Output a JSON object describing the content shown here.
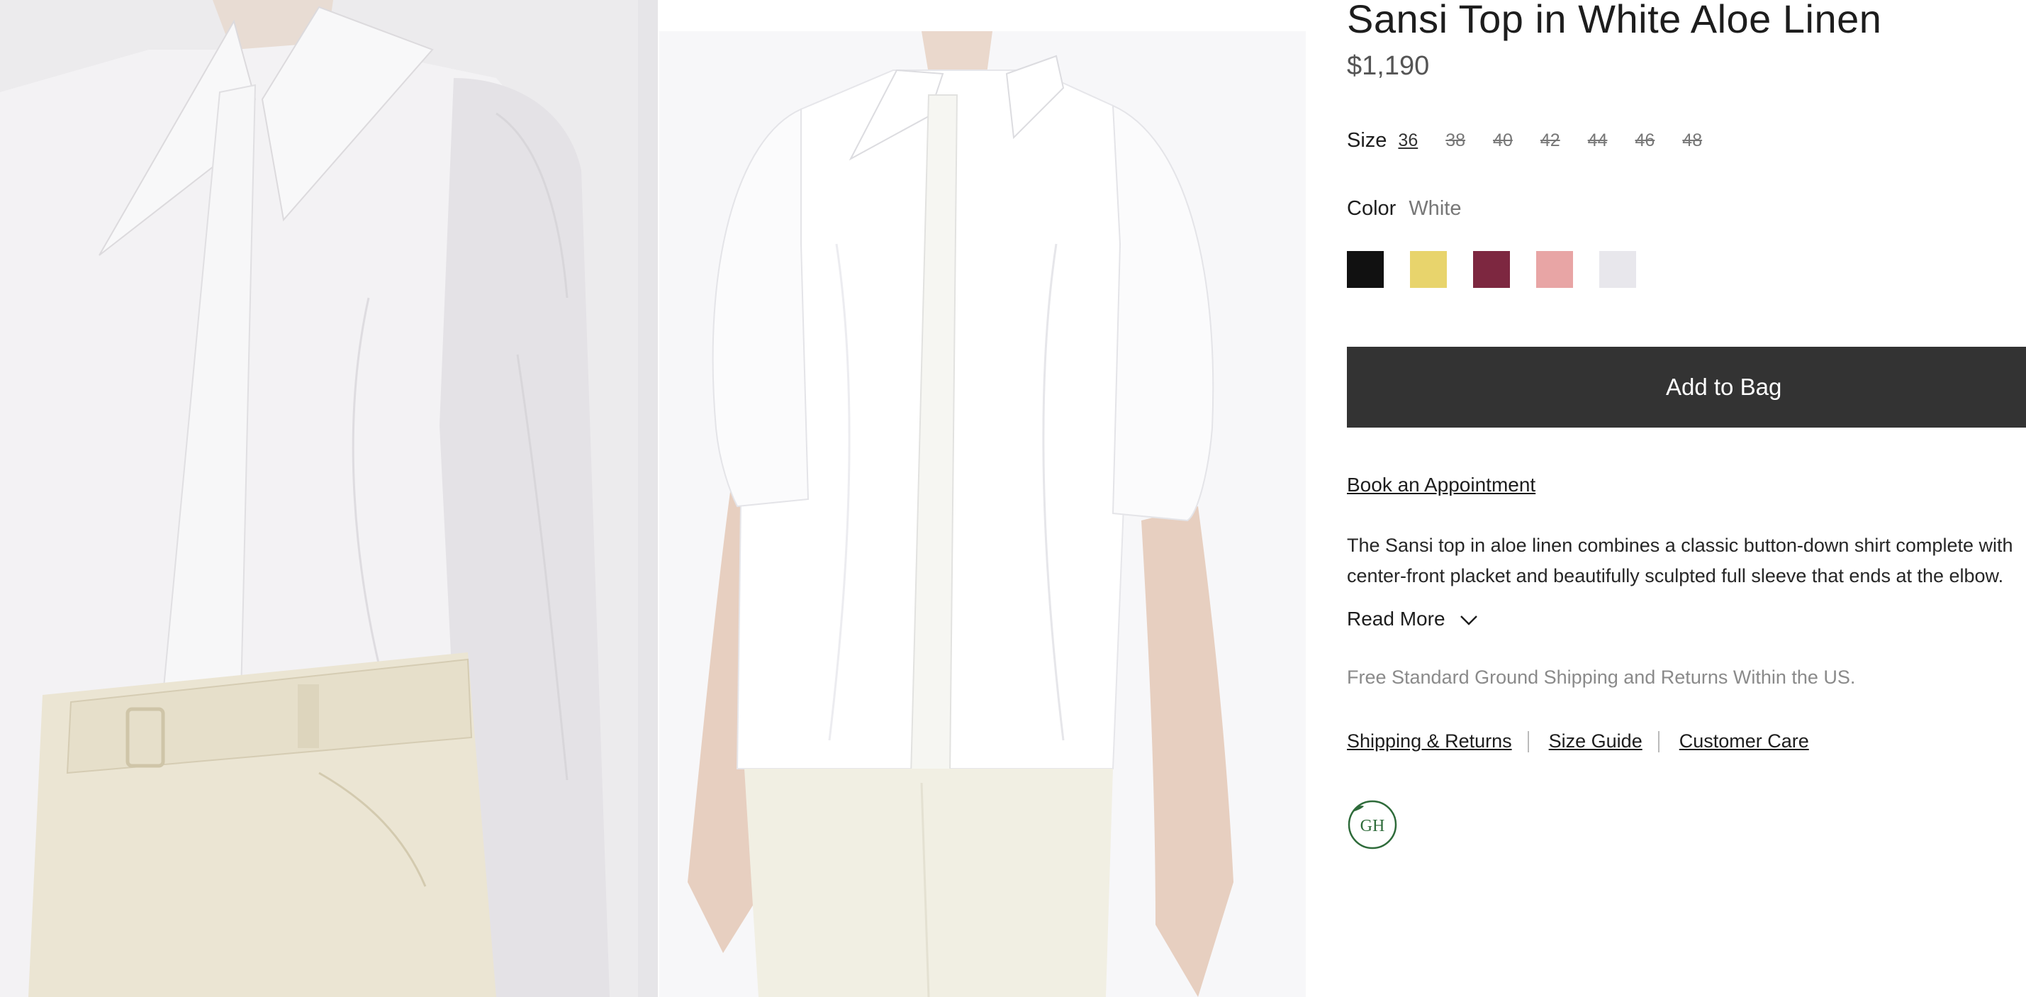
{
  "product": {
    "title": "Sansi Top in White Aloe Linen",
    "price": "$1,190"
  },
  "size": {
    "label": "Size",
    "options": [
      {
        "value": "36",
        "available": true,
        "selected": true
      },
      {
        "value": "38",
        "available": false,
        "selected": false
      },
      {
        "value": "40",
        "available": false,
        "selected": false
      },
      {
        "value": "42",
        "available": false,
        "selected": false
      },
      {
        "value": "44",
        "available": false,
        "selected": false
      },
      {
        "value": "46",
        "available": false,
        "selected": false
      },
      {
        "value": "48",
        "available": false,
        "selected": false
      }
    ]
  },
  "color": {
    "label": "Color",
    "selected": "White",
    "swatches": [
      {
        "hex": "#111111"
      },
      {
        "hex": "#e8d46c"
      },
      {
        "hex": "#7d2740"
      },
      {
        "hex": "#e8a5a5"
      },
      {
        "hex": "#e8e7ec"
      }
    ]
  },
  "actions": {
    "add_to_bag": "Add to Bag",
    "book_appointment": "Book an Appointment",
    "read_more": "Read More"
  },
  "description": {
    "line1": "The Sansi top in aloe linen combines a classic button-down shirt complete with",
    "line2": "center-front placket and beautifully sculpted full sleeve that ends at the elbow."
  },
  "shipping_note": "Free Standard Ground Shipping and Returns Within the US.",
  "info_links": {
    "shipping_returns": "Shipping & Returns",
    "size_guide": "Size Guide",
    "customer_care": "Customer Care"
  },
  "badge": {
    "monogram": "GH",
    "icon": "leaf-icon",
    "color": "#2e6b3a"
  },
  "images": {
    "left": {
      "description_icon": "product-detail-photo"
    },
    "right": {
      "description_icon": "product-model-photo"
    }
  }
}
